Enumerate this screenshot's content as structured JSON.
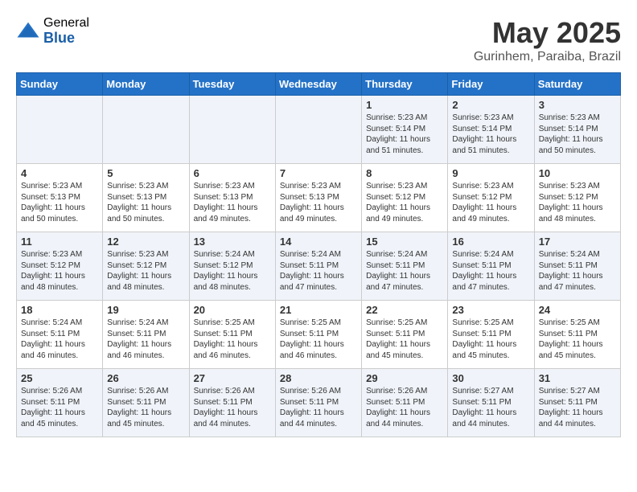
{
  "logo": {
    "general": "General",
    "blue": "Blue"
  },
  "title": "May 2025",
  "location": "Gurinhem, Paraiba, Brazil",
  "days_of_week": [
    "Sunday",
    "Monday",
    "Tuesday",
    "Wednesday",
    "Thursday",
    "Friday",
    "Saturday"
  ],
  "weeks": [
    [
      {
        "day": "",
        "content": ""
      },
      {
        "day": "",
        "content": ""
      },
      {
        "day": "",
        "content": ""
      },
      {
        "day": "",
        "content": ""
      },
      {
        "day": "1",
        "content": "Sunrise: 5:23 AM\nSunset: 5:14 PM\nDaylight: 11 hours\nand 51 minutes."
      },
      {
        "day": "2",
        "content": "Sunrise: 5:23 AM\nSunset: 5:14 PM\nDaylight: 11 hours\nand 51 minutes."
      },
      {
        "day": "3",
        "content": "Sunrise: 5:23 AM\nSunset: 5:14 PM\nDaylight: 11 hours\nand 50 minutes."
      }
    ],
    [
      {
        "day": "4",
        "content": "Sunrise: 5:23 AM\nSunset: 5:13 PM\nDaylight: 11 hours\nand 50 minutes."
      },
      {
        "day": "5",
        "content": "Sunrise: 5:23 AM\nSunset: 5:13 PM\nDaylight: 11 hours\nand 50 minutes."
      },
      {
        "day": "6",
        "content": "Sunrise: 5:23 AM\nSunset: 5:13 PM\nDaylight: 11 hours\nand 49 minutes."
      },
      {
        "day": "7",
        "content": "Sunrise: 5:23 AM\nSunset: 5:13 PM\nDaylight: 11 hours\nand 49 minutes."
      },
      {
        "day": "8",
        "content": "Sunrise: 5:23 AM\nSunset: 5:12 PM\nDaylight: 11 hours\nand 49 minutes."
      },
      {
        "day": "9",
        "content": "Sunrise: 5:23 AM\nSunset: 5:12 PM\nDaylight: 11 hours\nand 49 minutes."
      },
      {
        "day": "10",
        "content": "Sunrise: 5:23 AM\nSunset: 5:12 PM\nDaylight: 11 hours\nand 48 minutes."
      }
    ],
    [
      {
        "day": "11",
        "content": "Sunrise: 5:23 AM\nSunset: 5:12 PM\nDaylight: 11 hours\nand 48 minutes."
      },
      {
        "day": "12",
        "content": "Sunrise: 5:23 AM\nSunset: 5:12 PM\nDaylight: 11 hours\nand 48 minutes."
      },
      {
        "day": "13",
        "content": "Sunrise: 5:24 AM\nSunset: 5:12 PM\nDaylight: 11 hours\nand 48 minutes."
      },
      {
        "day": "14",
        "content": "Sunrise: 5:24 AM\nSunset: 5:11 PM\nDaylight: 11 hours\nand 47 minutes."
      },
      {
        "day": "15",
        "content": "Sunrise: 5:24 AM\nSunset: 5:11 PM\nDaylight: 11 hours\nand 47 minutes."
      },
      {
        "day": "16",
        "content": "Sunrise: 5:24 AM\nSunset: 5:11 PM\nDaylight: 11 hours\nand 47 minutes."
      },
      {
        "day": "17",
        "content": "Sunrise: 5:24 AM\nSunset: 5:11 PM\nDaylight: 11 hours\nand 47 minutes."
      }
    ],
    [
      {
        "day": "18",
        "content": "Sunrise: 5:24 AM\nSunset: 5:11 PM\nDaylight: 11 hours\nand 46 minutes."
      },
      {
        "day": "19",
        "content": "Sunrise: 5:24 AM\nSunset: 5:11 PM\nDaylight: 11 hours\nand 46 minutes."
      },
      {
        "day": "20",
        "content": "Sunrise: 5:25 AM\nSunset: 5:11 PM\nDaylight: 11 hours\nand 46 minutes."
      },
      {
        "day": "21",
        "content": "Sunrise: 5:25 AM\nSunset: 5:11 PM\nDaylight: 11 hours\nand 46 minutes."
      },
      {
        "day": "22",
        "content": "Sunrise: 5:25 AM\nSunset: 5:11 PM\nDaylight: 11 hours\nand 45 minutes."
      },
      {
        "day": "23",
        "content": "Sunrise: 5:25 AM\nSunset: 5:11 PM\nDaylight: 11 hours\nand 45 minutes."
      },
      {
        "day": "24",
        "content": "Sunrise: 5:25 AM\nSunset: 5:11 PM\nDaylight: 11 hours\nand 45 minutes."
      }
    ],
    [
      {
        "day": "25",
        "content": "Sunrise: 5:26 AM\nSunset: 5:11 PM\nDaylight: 11 hours\nand 45 minutes."
      },
      {
        "day": "26",
        "content": "Sunrise: 5:26 AM\nSunset: 5:11 PM\nDaylight: 11 hours\nand 45 minutes."
      },
      {
        "day": "27",
        "content": "Sunrise: 5:26 AM\nSunset: 5:11 PM\nDaylight: 11 hours\nand 44 minutes."
      },
      {
        "day": "28",
        "content": "Sunrise: 5:26 AM\nSunset: 5:11 PM\nDaylight: 11 hours\nand 44 minutes."
      },
      {
        "day": "29",
        "content": "Sunrise: 5:26 AM\nSunset: 5:11 PM\nDaylight: 11 hours\nand 44 minutes."
      },
      {
        "day": "30",
        "content": "Sunrise: 5:27 AM\nSunset: 5:11 PM\nDaylight: 11 hours\nand 44 minutes."
      },
      {
        "day": "31",
        "content": "Sunrise: 5:27 AM\nSunset: 5:11 PM\nDaylight: 11 hours\nand 44 minutes."
      }
    ]
  ]
}
